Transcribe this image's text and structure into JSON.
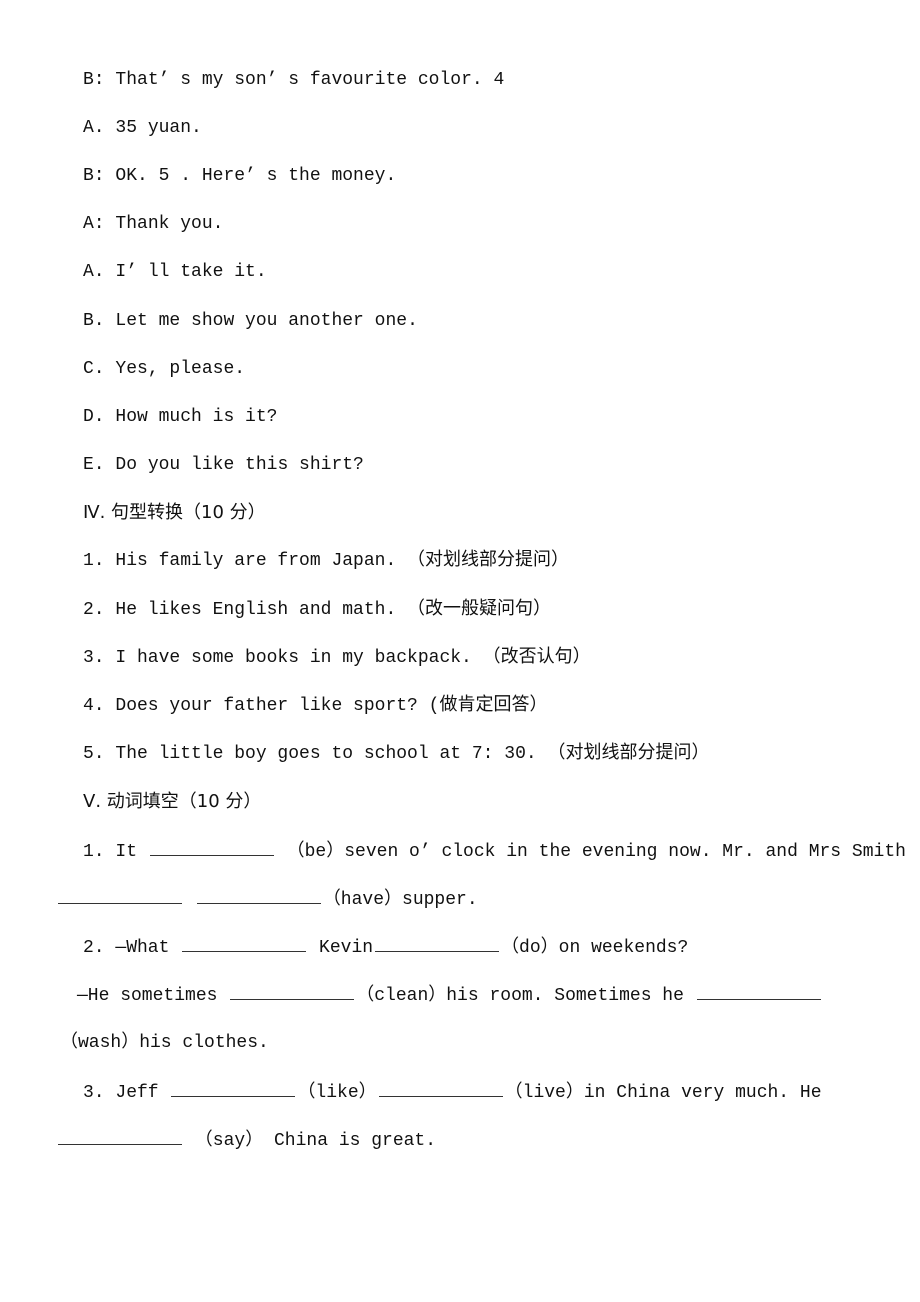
{
  "dialogue": [
    {
      "speaker": "B:",
      "text": "That’ s my son’ s favourite color. 4"
    },
    {
      "speaker": "A.",
      "text": "35 yuan."
    },
    {
      "speaker": "B:",
      "text": "OK. 5 . Here’ s the money."
    },
    {
      "speaker": "A:",
      "text": "Thank you."
    }
  ],
  "options": [
    {
      "letter": "A.",
      "text": "I’ ll take it."
    },
    {
      "letter": "B.",
      "text": "Let me show you another one."
    },
    {
      "letter": "C.",
      "text": "Yes, please."
    },
    {
      "letter": "D.",
      "text": "How much is it?"
    },
    {
      "letter": "E.",
      "text": "Do you like this shirt?"
    }
  ],
  "section4": {
    "heading": "Ⅳ. 句型转换（10 分）",
    "items": [
      "1. His family are from Japan. （对划线部分提问）",
      "2. He likes English and math. （改一般疑问句）",
      "3. I have some books in my backpack. （改否认句）",
      "4. Does your father like sport? (做肯定回答）",
      "5. The little boy goes to school at 7: 30. （对划线部分提问）"
    ]
  },
  "section5": {
    "heading": "Ⅴ. 动词填空（10 分）",
    "q1": {
      "a": "1. It",
      "b": " （be）seven o’ clock in the evening now. Mr. and Mrs Smith",
      "c": "（have）supper."
    },
    "q2": {
      "a": "2. —What",
      "b": "Kevin",
      "c": "（do）on weekends?",
      "d": "—He sometimes",
      "e": "（clean）his room. Sometimes he",
      "f": "（wash）his clothes."
    },
    "q3": {
      "a": "3. Jeff",
      "b": "（like）",
      "c": "（live）in China very much. He",
      "d": " （say） China is great."
    }
  }
}
